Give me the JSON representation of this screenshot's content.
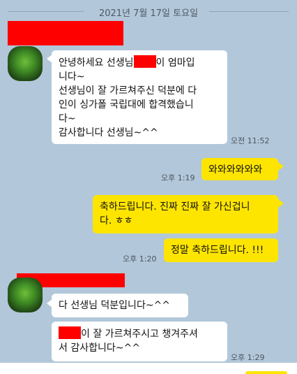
{
  "date_divider": "2021년 7월 17일 토요일",
  "messages": {
    "m1": {
      "line1_before": "안녕하세요 선생님",
      "line1_after": "이 엄마입",
      "rest": "니다~\n선생님이 잘 가르쳐주신 덕분에 다\n인이 싱가폴 국립대에 합격했습니\n다~\n감사합니다 선생님~^^",
      "time": "오전 11:52"
    },
    "m2": {
      "text": "와와와와와와",
      "time": "오후 1:19"
    },
    "m3": {
      "text": "축하드립니다. 진짜 진짜 잘 가신겁니\n다. ㅎㅎ"
    },
    "m4": {
      "text": "정말 축하드립니다. !!!",
      "time": "오후 1:20"
    },
    "m5": {
      "text": "다 선생님 덕분입니다~^^"
    },
    "m6": {
      "line1_after": "이 잘 가르쳐주시고 챙겨주셔",
      "rest": "서 감사합니다~^^",
      "time": "오후 1:29"
    }
  },
  "colors": {
    "background": "#b2c7d9",
    "incoming": "#ffffff",
    "outgoing": "#fee500",
    "redaction": "#ff0000"
  }
}
